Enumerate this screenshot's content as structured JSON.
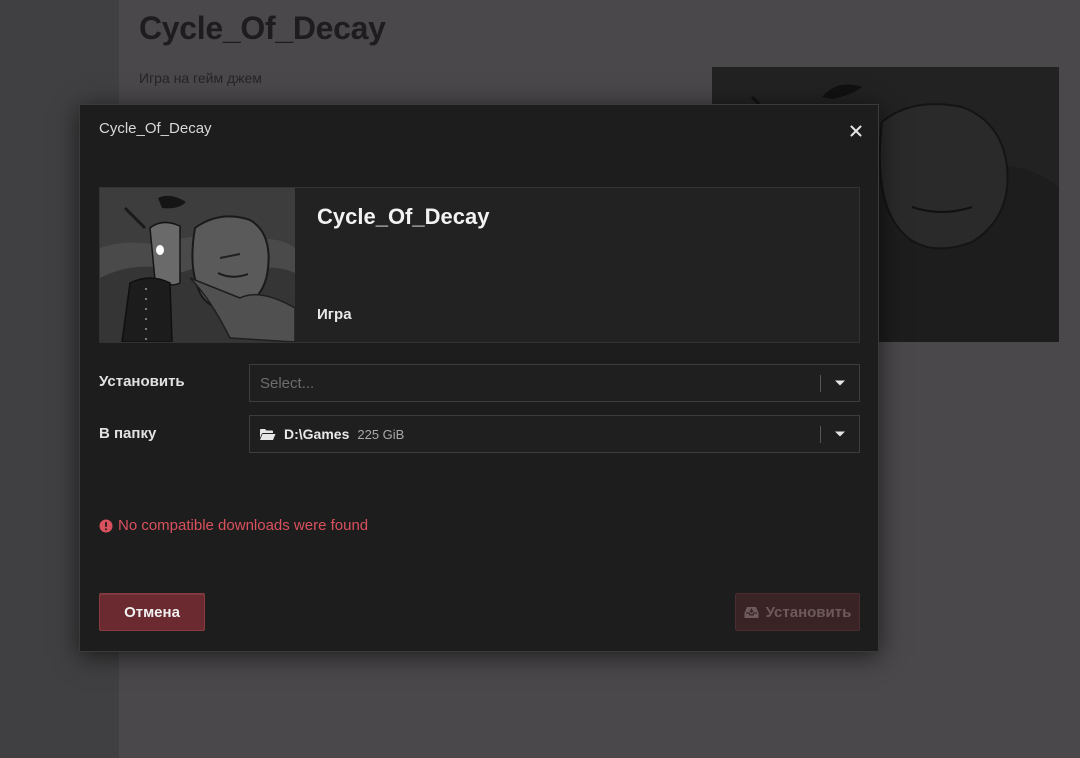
{
  "background": {
    "title": "Cycle_Of_Decay",
    "description": "Игра на гейм джем"
  },
  "modal": {
    "title": "Cycle_Of_Decay",
    "close_icon": "close-icon",
    "game": {
      "name": "Cycle_Of_Decay",
      "type": "Игра"
    },
    "install_field": {
      "label": "Установить",
      "placeholder": "Select...",
      "chevron_icon": "chevron-down-icon"
    },
    "folder_field": {
      "label": "В папку",
      "path": "D:\\Games",
      "free_space": "225 GiB",
      "folder_icon": "folder-open-icon"
    },
    "error": {
      "message": "No compatible downloads were found",
      "icon": "exclamation-circle-icon"
    },
    "buttons": {
      "cancel_label": "Отмена",
      "install_label": "Установить",
      "install_icon": "download-box-icon"
    }
  },
  "colors": {
    "accent": "#6b2a30",
    "error": "#d9515d",
    "modal_bg": "#1d1d1d"
  }
}
